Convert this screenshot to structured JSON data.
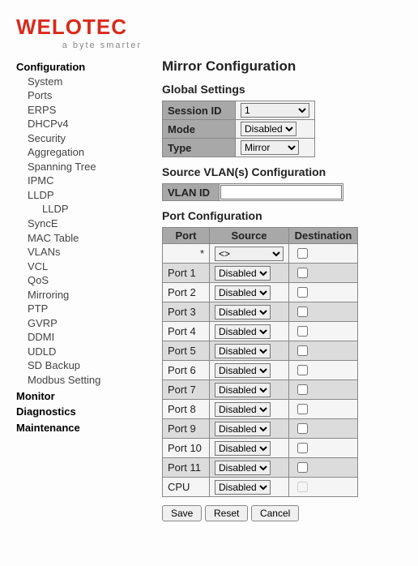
{
  "brand": {
    "name": "WELOTEC",
    "tagline": "a byte smarter",
    "color": "#d92a1c"
  },
  "nav": {
    "headings": [
      "Configuration",
      "Monitor",
      "Diagnostics",
      "Maintenance"
    ],
    "config_items": [
      "System",
      "Ports",
      "ERPS",
      "DHCPv4",
      "Security",
      "Aggregation",
      "Spanning Tree",
      "IPMC",
      "LLDP",
      "SyncE",
      "MAC Table",
      "VLANs",
      "VCL",
      "QoS",
      "Mirroring",
      "PTP",
      "GVRP",
      "DDMI",
      "UDLD",
      "SD Backup",
      "Modbus Setting"
    ],
    "lldp_sub": "LLDP"
  },
  "page": {
    "title": "Mirror Configuration",
    "sections": {
      "global": "Global Settings",
      "vlan": "Source VLAN(s) Configuration",
      "port": "Port Configuration"
    }
  },
  "global": {
    "rows": {
      "session_id": {
        "label": "Session ID",
        "value": "1"
      },
      "mode": {
        "label": "Mode",
        "value": "Disabled"
      },
      "type": {
        "label": "Type",
        "value": "Mirror"
      }
    }
  },
  "vlan": {
    "label": "VLAN ID",
    "value": ""
  },
  "port_table": {
    "headers": [
      "Port",
      "Source",
      "Destination"
    ],
    "wildcard": {
      "port": "*",
      "source": "<>"
    },
    "rows": [
      {
        "port": "Port 1",
        "source": "Disabled",
        "dest": false
      },
      {
        "port": "Port 2",
        "source": "Disabled",
        "dest": false
      },
      {
        "port": "Port 3",
        "source": "Disabled",
        "dest": false
      },
      {
        "port": "Port 4",
        "source": "Disabled",
        "dest": false
      },
      {
        "port": "Port 5",
        "source": "Disabled",
        "dest": false
      },
      {
        "port": "Port 6",
        "source": "Disabled",
        "dest": false
      },
      {
        "port": "Port 7",
        "source": "Disabled",
        "dest": false
      },
      {
        "port": "Port 8",
        "source": "Disabled",
        "dest": false
      },
      {
        "port": "Port 9",
        "source": "Disabled",
        "dest": false
      },
      {
        "port": "Port 10",
        "source": "Disabled",
        "dest": false
      },
      {
        "port": "Port 11",
        "source": "Disabled",
        "dest": false
      },
      {
        "port": "CPU",
        "source": "Disabled",
        "dest": null
      }
    ]
  },
  "buttons": {
    "save": "Save",
    "reset": "Reset",
    "cancel": "Cancel"
  }
}
